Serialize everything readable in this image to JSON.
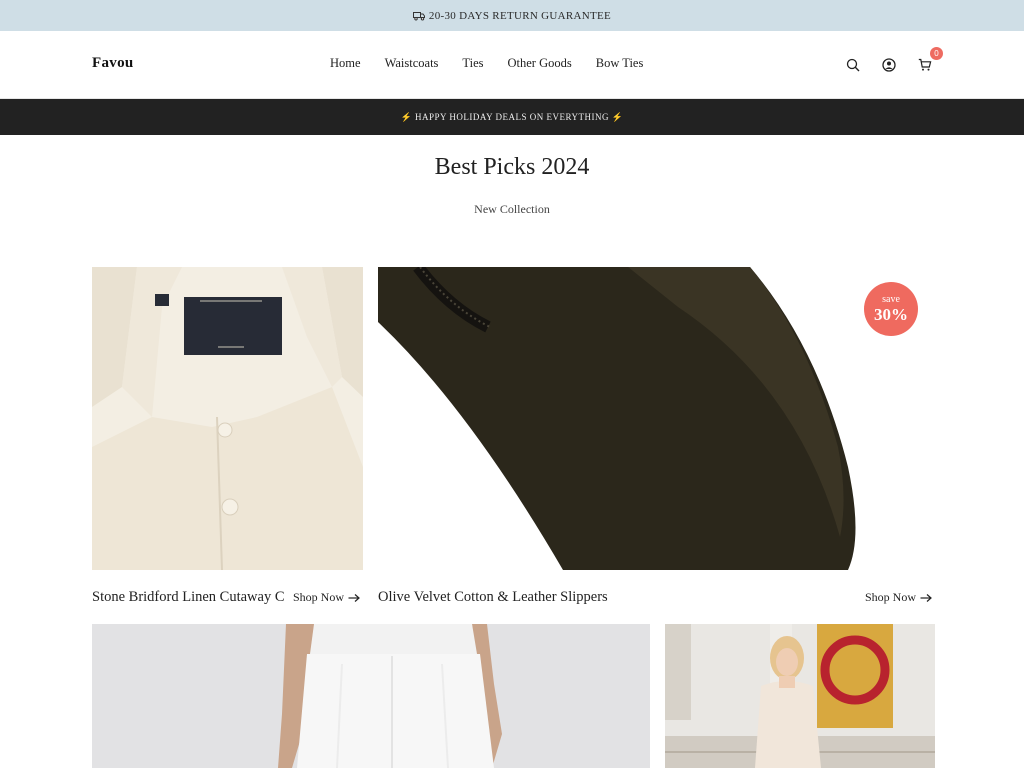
{
  "announcement": {
    "text": "20-30 DAYS RETURN GUARANTEE",
    "icon": "truck-icon"
  },
  "header": {
    "logo": "Favou",
    "nav": [
      "Home",
      "Waistcoats",
      "Ties",
      "Other Goods",
      "Bow Ties"
    ],
    "icons": [
      "search-icon",
      "account-icon",
      "cart-icon"
    ],
    "cart_count": "0"
  },
  "promo": {
    "text": "⚡ HAPPY HOLIDAY DEALS ON EVERYTHING ⚡"
  },
  "section": {
    "title": "Best Picks 2024",
    "subtitle": "New Collection"
  },
  "products": [
    {
      "name": "Stone Bridford Linen Cutaway C",
      "cta": "Shop Now"
    },
    {
      "name": "Olive Velvet Cotton & Leather Slippers",
      "cta": "Shop Now",
      "badge_line1": "save",
      "badge_line2": "30%"
    }
  ],
  "colors": {
    "announce_bg": "#cfdee6",
    "promo_bg": "#222222",
    "badge": "#ef6a5f"
  }
}
